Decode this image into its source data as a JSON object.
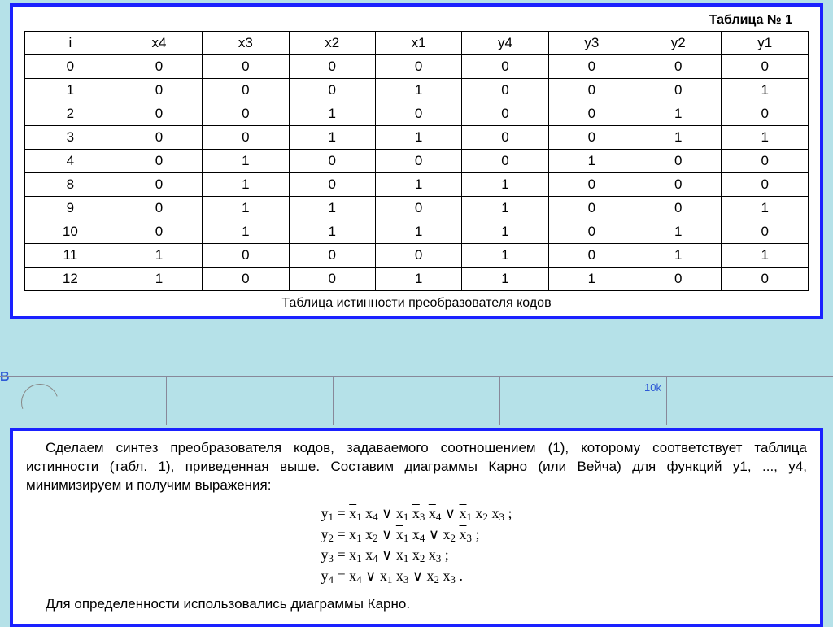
{
  "table": {
    "title_label": "Таблица № 1",
    "headers": [
      "i",
      "x4",
      "x3",
      "x2",
      "x1",
      "y4",
      "y3",
      "y2",
      "y1"
    ],
    "rows": [
      [
        "0",
        "0",
        "0",
        "0",
        "0",
        "0",
        "0",
        "0",
        "0"
      ],
      [
        "1",
        "0",
        "0",
        "0",
        "1",
        "0",
        "0",
        "0",
        "1"
      ],
      [
        "2",
        "0",
        "0",
        "1",
        "0",
        "0",
        "0",
        "1",
        "0"
      ],
      [
        "3",
        "0",
        "0",
        "1",
        "1",
        "0",
        "0",
        "1",
        "1"
      ],
      [
        "4",
        "0",
        "1",
        "0",
        "0",
        "0",
        "1",
        "0",
        "0"
      ],
      [
        "8",
        "0",
        "1",
        "0",
        "1",
        "1",
        "0",
        "0",
        "0"
      ],
      [
        "9",
        "0",
        "1",
        "1",
        "0",
        "1",
        "0",
        "0",
        "1"
      ],
      [
        "10",
        "0",
        "1",
        "1",
        "1",
        "1",
        "0",
        "1",
        "0"
      ],
      [
        "11",
        "1",
        "0",
        "0",
        "0",
        "1",
        "0",
        "1",
        "1"
      ],
      [
        "12",
        "1",
        "0",
        "0",
        "1",
        "1",
        "1",
        "0",
        "0"
      ]
    ],
    "caption": "Таблица истинности преобразователя кодов"
  },
  "bg": {
    "left_b": "В",
    "tenk": "10k"
  },
  "paragraphs": {
    "p1": "Сделаем синтез преобразователя кодов, задаваемого соотношением (1), которому соответствует таблица истинности (табл. 1), приведенная выше. Составим диаграммы Карно (или Вейча) для функций у1, ..., у4, минимизируем и получим выражения:",
    "footer": "Для определенности использовались диаграммы Карно."
  },
  "chart_data": {
    "type": "table",
    "title": "Таблица № 1",
    "columns": [
      "i",
      "x4",
      "x3",
      "x2",
      "x1",
      "y4",
      "y3",
      "y2",
      "y1"
    ],
    "rows": [
      [
        0,
        0,
        0,
        0,
        0,
        0,
        0,
        0,
        0
      ],
      [
        1,
        0,
        0,
        0,
        1,
        0,
        0,
        0,
        1
      ],
      [
        2,
        0,
        0,
        1,
        0,
        0,
        0,
        1,
        0
      ],
      [
        3,
        0,
        0,
        1,
        1,
        0,
        0,
        1,
        1
      ],
      [
        4,
        0,
        1,
        0,
        0,
        0,
        1,
        0,
        0
      ],
      [
        8,
        0,
        1,
        0,
        1,
        1,
        0,
        0,
        0
      ],
      [
        9,
        0,
        1,
        1,
        0,
        1,
        0,
        0,
        1
      ],
      [
        10,
        0,
        1,
        1,
        1,
        1,
        0,
        1,
        0
      ],
      [
        11,
        1,
        0,
        0,
        0,
        1,
        0,
        1,
        1
      ],
      [
        12,
        1,
        0,
        0,
        1,
        1,
        1,
        0,
        0
      ]
    ]
  },
  "formulas": {
    "y1": "y₁ = x̄₁x₄ ∨ x₁x̄₃x̄₄ ∨ x̄₁x₂x₃ ;",
    "y2": "y₂ = x₁x₂ ∨ x̄₁x₄ ∨ x₂x̄₃ ;",
    "y3": "y₃ = x₁x₄ ∨ x̄₁x̄₂x₃ ;",
    "y4": "y₄ = x₄ ∨ x₁x₃ ∨ x₂x₃ ."
  }
}
